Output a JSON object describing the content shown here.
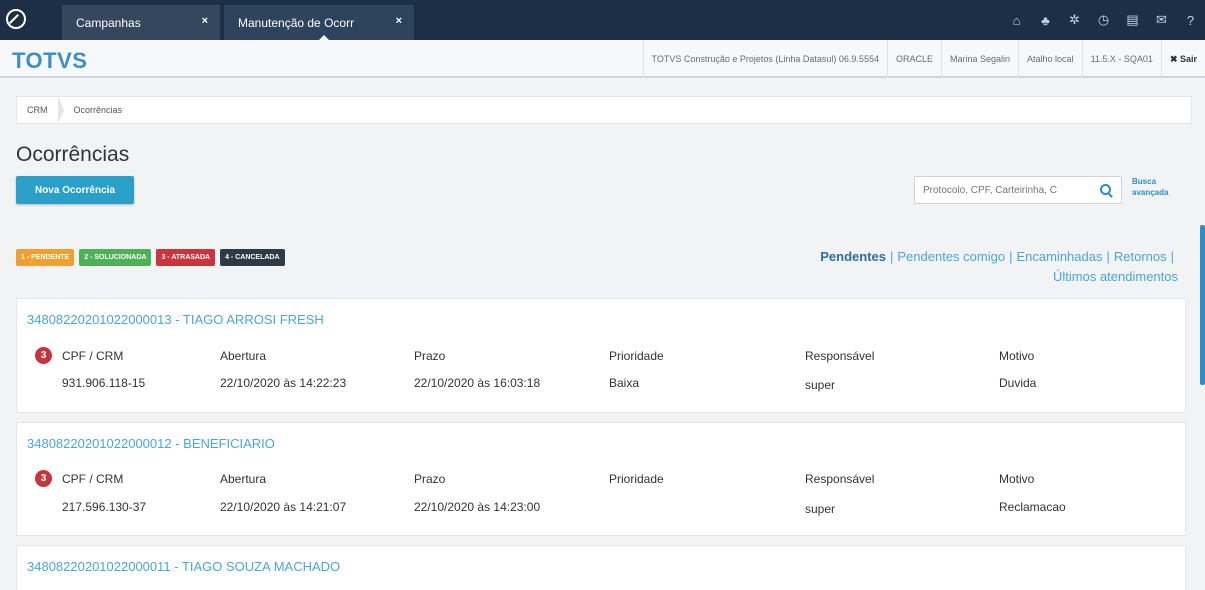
{
  "tabs": [
    {
      "label": "Campanhas",
      "close": "×"
    },
    {
      "label": "Manutenção de Ocorr",
      "close": "×"
    }
  ],
  "topbar_icons": [
    "home-icon",
    "sitemap-icon",
    "gear-icon",
    "clock-icon",
    "document-icon",
    "mail-icon",
    "help-icon"
  ],
  "header": {
    "brand": "TOTVS",
    "company": "TOTVS Construção e Projetos (Linha Datasul) 06.9.5554",
    "database": "ORACLE",
    "user": "Marina Segalin",
    "shortcut": "Atalho local",
    "version": "11.5.X - SQA01",
    "exit": "✖ Sair"
  },
  "breadcrumb": [
    "CRM",
    "Ocorrências"
  ],
  "page_title": "Ocorrências",
  "new_button": "Nova Ocorrência",
  "search": {
    "placeholder": "Protocolo, CPF, Carteirinha, C"
  },
  "advanced_search": "Busca avançada",
  "legend": [
    {
      "label": "1 - PENDENTE",
      "color": "#f0a030"
    },
    {
      "label": "2 - SOLUCIONADA",
      "color": "#4fb157"
    },
    {
      "label": "3 - ATRASADA",
      "color": "#c8353c"
    },
    {
      "label": "4 - CANCELADA",
      "color": "#2e3a45"
    }
  ],
  "filters": {
    "active": "Pendentes",
    "items": [
      "Pendentes comigo",
      "Encaminhadas",
      "Retornos"
    ],
    "last": "Últimos atendimentos"
  },
  "columns": [
    "CPF / CRM",
    "Abertura",
    "Prazo",
    "Prioridade",
    "Responsável",
    "Motivo"
  ],
  "records": [
    {
      "title": "34808220201022000013 - TIAGO ARROSI FRESH",
      "status": "3",
      "values": [
        "931.906.118-15",
        "22/10/2020 às 14:22:23",
        "22/10/2020 às 16:03:18",
        "Baixa",
        "super",
        "Duvida"
      ]
    },
    {
      "title": "34808220201022000012 - BENEFICIARIO",
      "status": "3",
      "values": [
        "217.596.130-37",
        "22/10/2020 às 14:21:07",
        "22/10/2020 às 14:23:00",
        "",
        "super",
        "Reclamacao"
      ]
    },
    {
      "title": "34808220201022000011 - TIAGO SOUZA MACHADO"
    }
  ]
}
